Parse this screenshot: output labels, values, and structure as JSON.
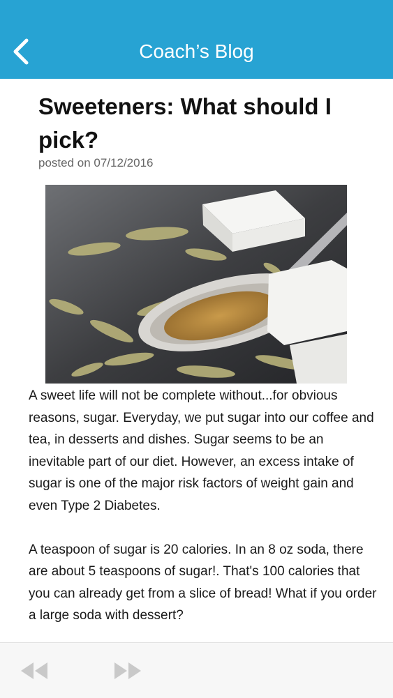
{
  "nav": {
    "title": "Coach’s Blog",
    "back_icon": "chevron-left-icon",
    "bg_color": "#27a3d3"
  },
  "post": {
    "title": "Sweeteners: What should I pick?",
    "date": "posted on 07/12/2016",
    "paragraphs": [
      "A sweet life will not be complete without...for obvious reasons, sugar. Everyday, we put sugar into our coffee and tea, in desserts and dishes. Sugar seems to be an inevitable part of our diet. However, an excess intake of sugar is one of the major risk factors of weight gain and even Type 2 Diabetes.",
      "A teaspoon of sugar is 20 calories. In an 8 oz soda, there are about 5 teaspoons of sugar!. That's 100 calories that you can already get from a slice of bread! What if you order a large soda with dessert?"
    ]
  },
  "toolbar": {
    "rewind_icon": "rewind-icon",
    "forward_icon": "fast-forward-icon"
  }
}
